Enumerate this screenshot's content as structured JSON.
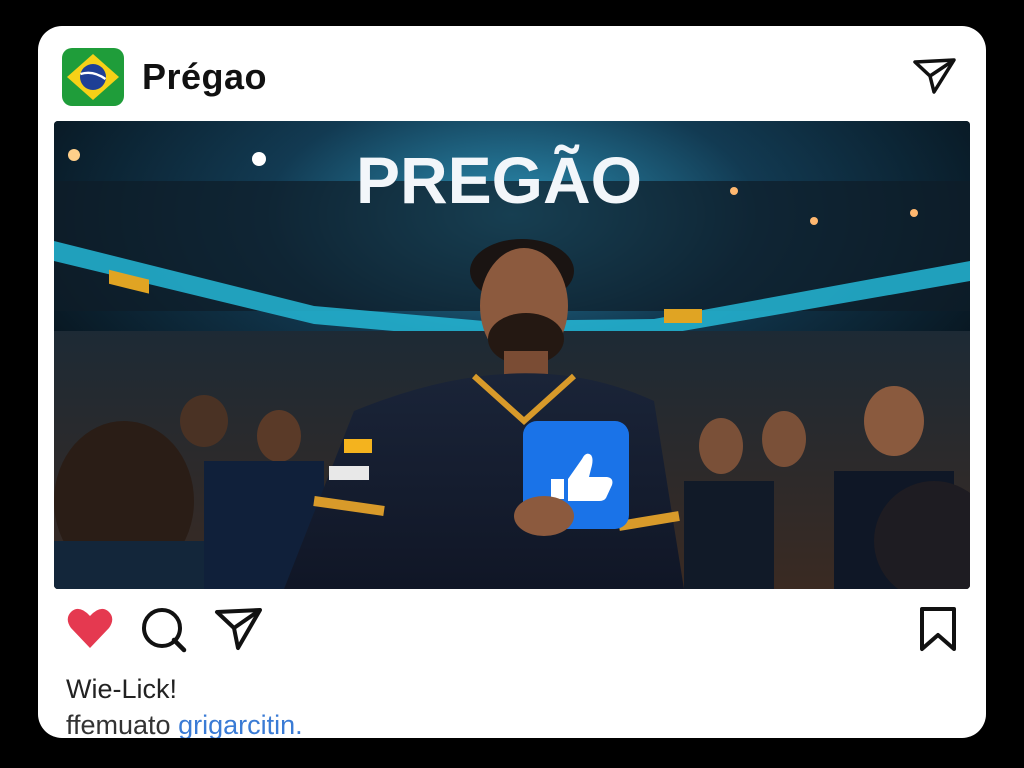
{
  "post": {
    "username": "Prégao",
    "avatar_icon": "brazil-flag-icon",
    "header_share_icon": "paper-plane-icon",
    "image": {
      "headline": "PREGÃO",
      "overlay_icon": "thumbs-up-icon",
      "accent_color": "#1a73e8"
    },
    "actions": {
      "like_icon": "heart-icon",
      "like_color": "#e53950",
      "comment_icon": "comment-icon",
      "share_icon": "paper-plane-icon",
      "save_icon": "bookmark-icon"
    },
    "caption": {
      "line1": "Wie-Lick!",
      "line2_prefix": "ffemuato ",
      "line2_link": "grigarcitin."
    }
  }
}
